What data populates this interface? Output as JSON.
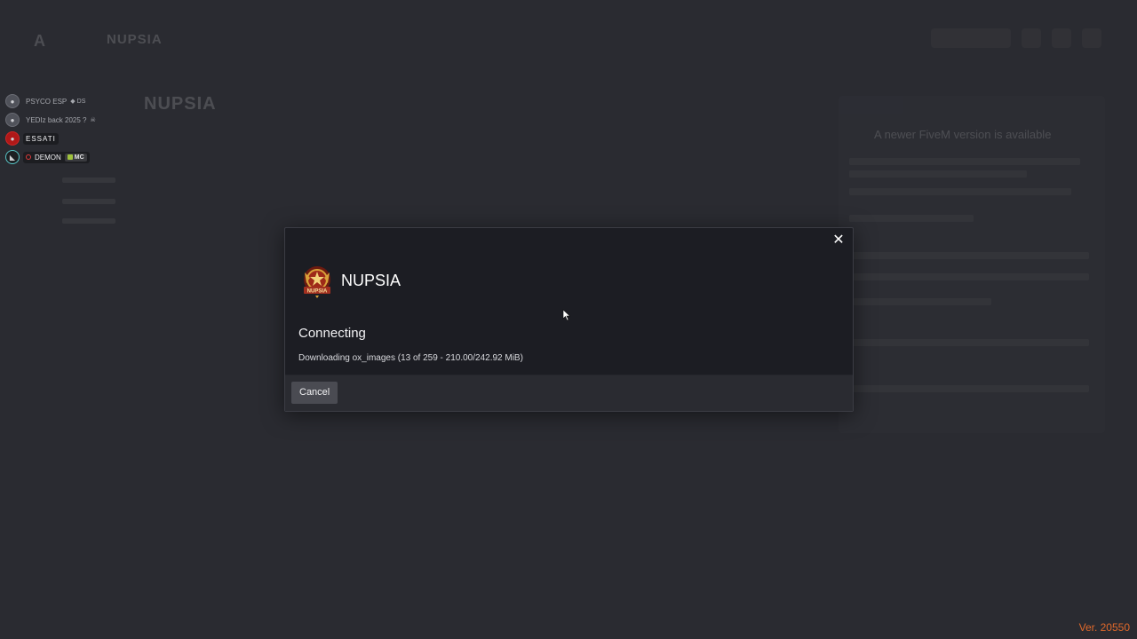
{
  "background": {
    "brand": "NUPSIA",
    "server_title": "NUPSIA",
    "panel_title": "A newer FiveM version is available"
  },
  "players": [
    {
      "name": "PSYCO ESP",
      "tag": "DS",
      "avatar": "grey"
    },
    {
      "name": "YEDIz back 2025 ?",
      "tag": "",
      "avatar": "grey"
    },
    {
      "name": "ESSATI",
      "tag": "",
      "avatar": "red"
    },
    {
      "name": "DEMON",
      "tag": "MC",
      "avatar": "dark"
    }
  ],
  "dialog": {
    "server_name": "NUPSIA",
    "logo_text": "NUPSIA",
    "status": "Connecting",
    "progress": "Downloading ox_images (13 of 259 - 210.00/242.92 MiB)",
    "cancel_label": "Cancel",
    "close_symbol": "✕"
  },
  "version": "Ver. 20550",
  "colors": {
    "accent_orange": "#e0692b",
    "dialog_bg": "#1c1d23",
    "footer_bg": "#2a2b31"
  }
}
